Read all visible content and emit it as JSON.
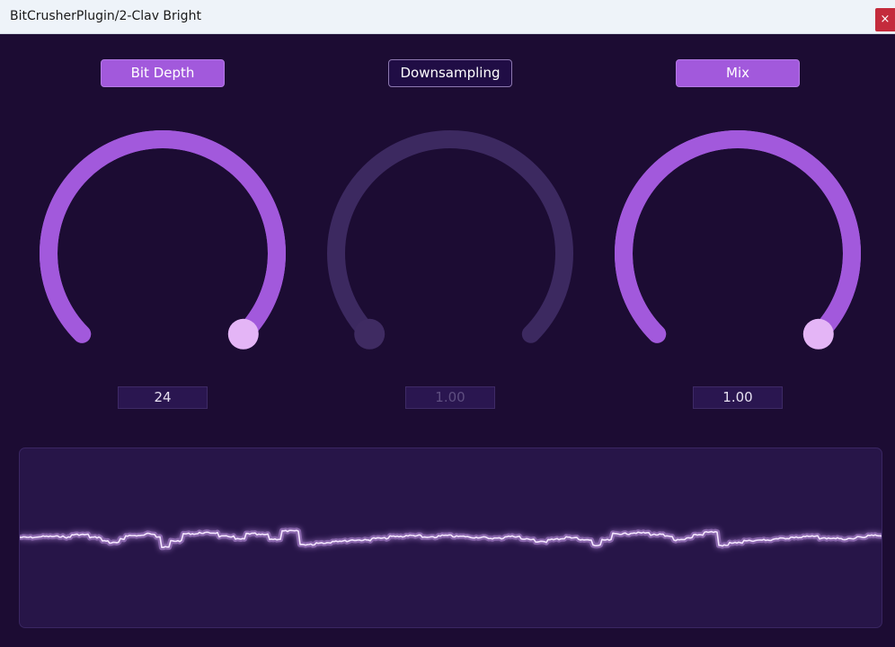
{
  "window": {
    "title": "BitCrusherPlugin/2-Clav Bright",
    "close_glyph": "×",
    "close_icon": "close-icon"
  },
  "colors": {
    "background": "#1c0c33",
    "accent": "#a259dc",
    "track_inactive": "#3c2960",
    "thumb_active": "#e4b5f6",
    "thumb_inactive": "#3f2b62",
    "scope_line": "#d9a9ff"
  },
  "params": [
    {
      "label": "Bit Depth",
      "value_text": "24",
      "enabled": true,
      "level": 1.0
    },
    {
      "label": "Downsampling",
      "value_text": "1.00",
      "enabled": false,
      "level": 0.0
    },
    {
      "label": "Mix",
      "value_text": "1.00",
      "enabled": true,
      "level": 1.0
    }
  ]
}
